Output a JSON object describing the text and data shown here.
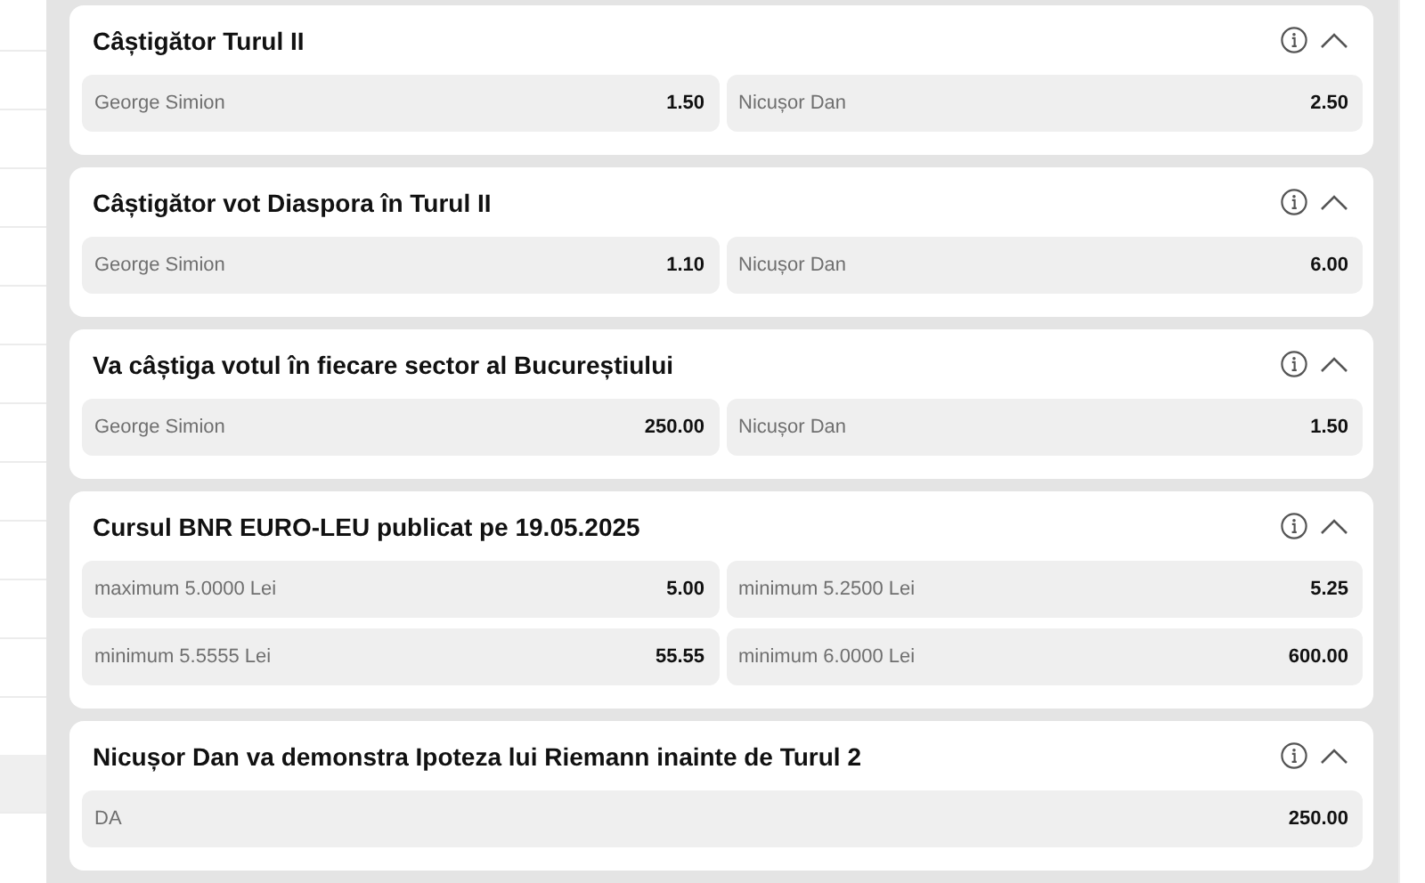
{
  "markets": [
    {
      "title": "Câștigător Turul II",
      "expanded": true,
      "selections": [
        {
          "label": "George Simion",
          "odds": "1.50"
        },
        {
          "label": "Nicușor Dan",
          "odds": "2.50"
        }
      ]
    },
    {
      "title": "Câștigător vot Diaspora în Turul II",
      "expanded": true,
      "selections": [
        {
          "label": "George Simion",
          "odds": "1.10"
        },
        {
          "label": "Nicușor Dan",
          "odds": "6.00"
        }
      ]
    },
    {
      "title": "Va câștiga votul în fiecare sector al Bucureștiului",
      "expanded": true,
      "selections": [
        {
          "label": "George Simion",
          "odds": "250.00"
        },
        {
          "label": "Nicușor Dan",
          "odds": "1.50"
        }
      ]
    },
    {
      "title": "Cursul BNR EURO-LEU publicat pe 19.05.2025",
      "expanded": true,
      "selections": [
        {
          "label": "maximum 5.0000 Lei",
          "odds": "5.00"
        },
        {
          "label": "minimum 5.2500 Lei",
          "odds": "5.25"
        },
        {
          "label": "minimum 5.5555 Lei",
          "odds": "55.55"
        },
        {
          "label": "minimum 6.0000 Lei",
          "odds": "600.00"
        }
      ]
    },
    {
      "title": "Nicușor Dan va demonstra Ipoteza lui Riemann inainte de Turul 2",
      "expanded": true,
      "selections": [
        {
          "label": "DA",
          "odds": "250.00"
        }
      ]
    }
  ]
}
